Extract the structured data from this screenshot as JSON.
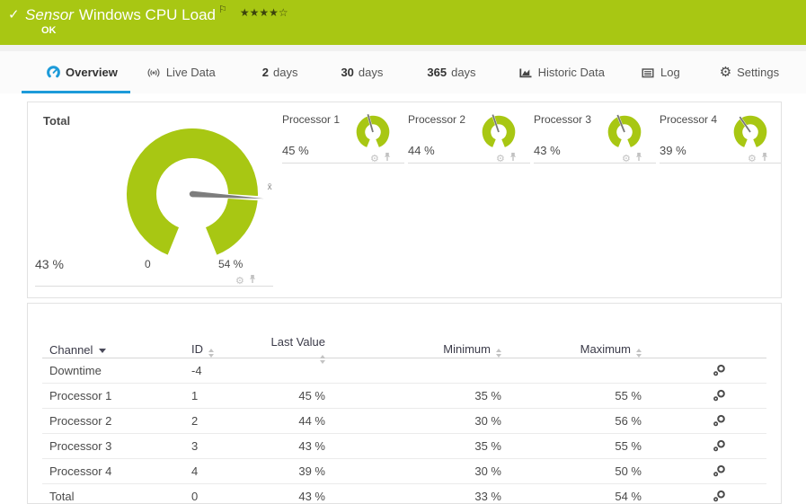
{
  "header": {
    "type_label": "Sensor",
    "title": "Windows CPU Load",
    "status": "OK",
    "rating": {
      "filled": 4,
      "total": 5
    },
    "colors": {
      "bar": "#a8c713",
      "star": "#3c430c",
      "text": "#ffffff"
    }
  },
  "tabs": [
    {
      "label": "Overview",
      "icon": "gauge-icon",
      "selected": true
    },
    {
      "label": "Live Data",
      "icon": "live-data-icon"
    },
    {
      "prefix": "2",
      "label": "days"
    },
    {
      "prefix": "30",
      "label": "days"
    },
    {
      "prefix": "365",
      "label": "days"
    },
    {
      "label": "Historic Data",
      "icon": "historic-chart-icon"
    },
    {
      "label": "Log",
      "icon": "log-icon"
    },
    {
      "label": "Settings",
      "icon": "settings-gear-icon"
    }
  ],
  "gauges": {
    "color": "#a8c713",
    "needle_color": "#7d7d7d",
    "total": {
      "label": "Total",
      "value": 43,
      "value_label": "43 %",
      "scale_min_label": "0",
      "scale_max_label": "54 %",
      "scale_max": 54,
      "avg_marker": "x̄"
    },
    "processors": [
      {
        "label": "Processor 1",
        "value": 45,
        "value_label": "45 %",
        "scale_max": 100
      },
      {
        "label": "Processor 2",
        "value": 44,
        "value_label": "44 %",
        "scale_max": 100
      },
      {
        "label": "Processor 3",
        "value": 43,
        "value_label": "43 %",
        "scale_max": 100
      },
      {
        "label": "Processor 4",
        "value": 39,
        "value_label": "39 %",
        "scale_max": 100
      }
    ]
  },
  "table": {
    "columns": [
      {
        "label": "Channel",
        "sort": "active"
      },
      {
        "label": "ID",
        "sort": "both"
      },
      {
        "label": "Last Value",
        "sort": "both"
      },
      {
        "label": "Minimum",
        "sort": "both"
      },
      {
        "label": "Maximum",
        "sort": "both"
      }
    ],
    "rows": [
      {
        "channel": "Downtime",
        "id": "-4",
        "last": "",
        "min": "",
        "max": ""
      },
      {
        "channel": "Processor 1",
        "id": "1",
        "last": "45 %",
        "min": "35 %",
        "max": "55 %"
      },
      {
        "channel": "Processor 2",
        "id": "2",
        "last": "44 %",
        "min": "30 %",
        "max": "56 %"
      },
      {
        "channel": "Processor 3",
        "id": "3",
        "last": "43 %",
        "min": "35 %",
        "max": "55 %"
      },
      {
        "channel": "Processor 4",
        "id": "4",
        "last": "39 %",
        "min": "30 %",
        "max": "50 %"
      },
      {
        "channel": "Total",
        "id": "0",
        "last": "43 %",
        "min": "33 %",
        "max": "54 %"
      }
    ]
  }
}
